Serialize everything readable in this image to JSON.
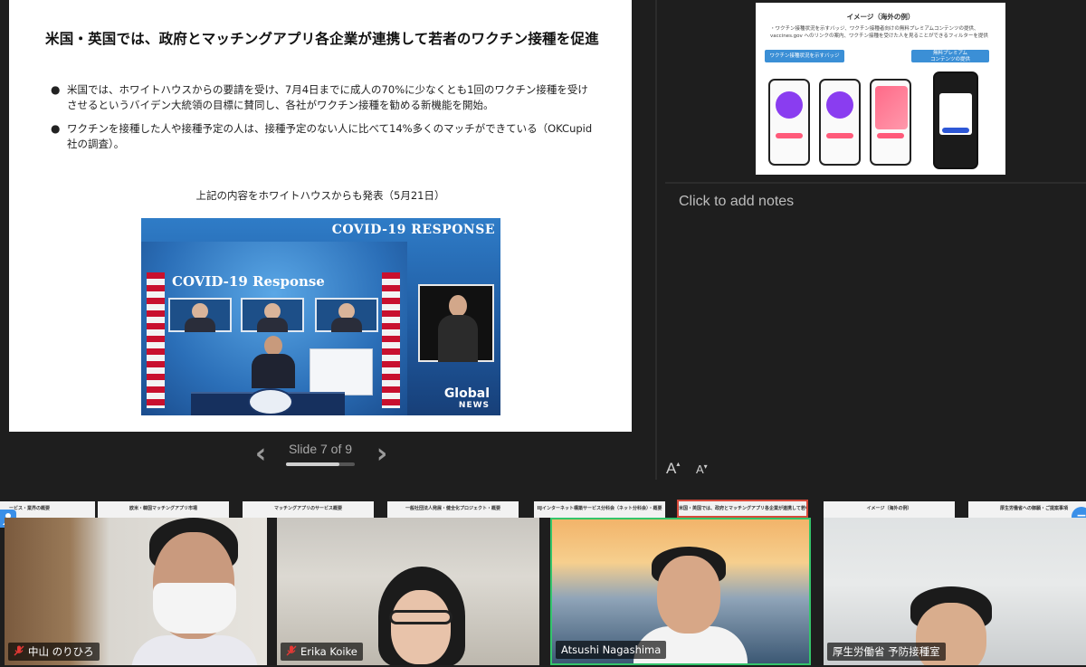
{
  "slide": {
    "title": "米国・英国では、政府とマッチングアプリ各企業が連携して若者のワクチン接種を促進",
    "bullets": [
      "米国では、ホワイトハウスからの要請を受け、7月4日までに成人の70%に少なくとも1回のワクチン接種を受けさせるというバイデン大統領の目標に賛同し、各社がワクチン接種を勧める新機能を開始。",
      "ワクチンを接種した人や接種予定の人は、接種予定のない人に比べて14%多くのマッチができている（OKCupid社の調査）。"
    ],
    "bullet_marker": "●",
    "caption": "上記の内容をホワイトハウスからも発表（5月21日）",
    "photo": {
      "banner": "COVID-19 RESPONSE",
      "heading": "COVID-19 Response",
      "logo": "Global",
      "logo_sub": "NEWS"
    }
  },
  "navigation": {
    "prev": "‹",
    "next": "›",
    "counter": "Slide 7 of 9",
    "current": 7,
    "total": 9
  },
  "next_slide": {
    "title": "イメージ（海外の例）",
    "text": "・ワクチン接種状況を示すバッジ、ワクチン接種者向けの無料プレミアムコンテンツの提供、vaccines.gov へのリンクの案内、ワクチン接種を受けた人を見ることができるフィルターを提供",
    "pill_left": "ワクチン接種状況を示すバッジ",
    "pill_right": "無料プレミアム\nコンテンツの提供"
  },
  "notes": {
    "placeholder": "Click to add notes",
    "font_increase": "A",
    "font_decrease": "A",
    "increase_mark": "▴",
    "decrease_mark": "▾"
  },
  "filmstrip": [
    {
      "label": "ービス・業界の概要"
    },
    {
      "label": "欧米・韓国マッチングアプリ市場"
    },
    {
      "label": "マッチングアプリのサービス概要"
    },
    {
      "label": "一般社団法人発展・健全化プロジェクト・概要"
    },
    {
      "label": "IIJインターネット構築サービス分科会（ネット分科会）・概要"
    },
    {
      "label": "米国・英国では、政府とマッチングアプリ各企業が連携して若者のワクチン接種を促進",
      "active": true
    },
    {
      "label": "イメージ（海外の例）"
    },
    {
      "label": "厚生労働省への御願・ご提案事項"
    }
  ],
  "participants": [
    {
      "name": "中山 のりひろ",
      "muted": true
    },
    {
      "name": "Erika Koike",
      "muted": true
    },
    {
      "name": "Atsushi Nagashima",
      "muted": false,
      "speaking": true
    },
    {
      "name": "厚生労働省 予防接種室",
      "muted": false
    }
  ],
  "side_buttons": {
    "left_icon": "person-icon",
    "right_icon": "minus-icon",
    "right_symbol": "−"
  },
  "colors": {
    "background": "#1e1e1e",
    "speaking_border": "#34c56b",
    "active_thumb_border": "#d64a3a",
    "mute_icon": "#e53935",
    "badge_blue": "#3a8fe8"
  }
}
